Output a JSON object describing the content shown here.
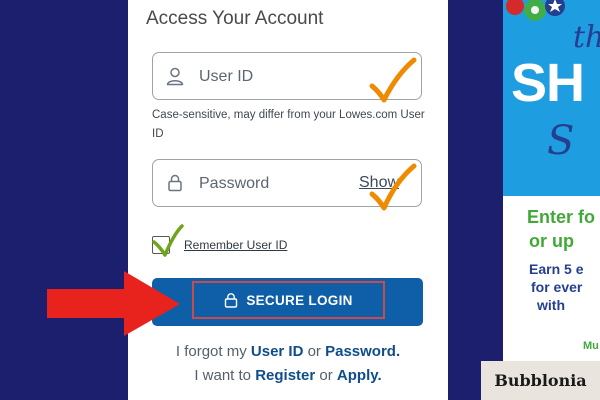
{
  "login": {
    "title": "Access Your Account",
    "userid_placeholder": "User ID",
    "userid_helper": "Case-sensitive, may differ from your Lowes.com User ID",
    "password_placeholder": "Password",
    "show_label": "Show",
    "remember_label": "Remember User ID",
    "remember_checked": true,
    "secure_login_label": "SECURE LOGIN",
    "forgot_prefix": "I forgot my",
    "forgot_userid": "User ID",
    "forgot_or": "or",
    "forgot_password": "Password.",
    "want_prefix": "I want to",
    "register": "Register",
    "want_or": "or",
    "apply": "Apply."
  },
  "ad": {
    "script_top": "th",
    "headline": "SH",
    "script_bottom": "S",
    "enter_line1": "Enter fo",
    "enter_line2": "or up",
    "earn_line1": "Earn 5 e",
    "earn_line2": "for ever",
    "earn_line3": "with",
    "footer": "Mu"
  },
  "watermark": "Bubblonia",
  "colors": {
    "page_background": "#1b1f6e",
    "primary_button": "#0f5fa8",
    "link": "#0f4d8c",
    "annotation_check": "#f08a00",
    "annotation_arrow": "#e8231e",
    "annotation_box": "#c94b4b",
    "ad_blue": "#1e9de0",
    "ad_green": "#43a83a"
  }
}
